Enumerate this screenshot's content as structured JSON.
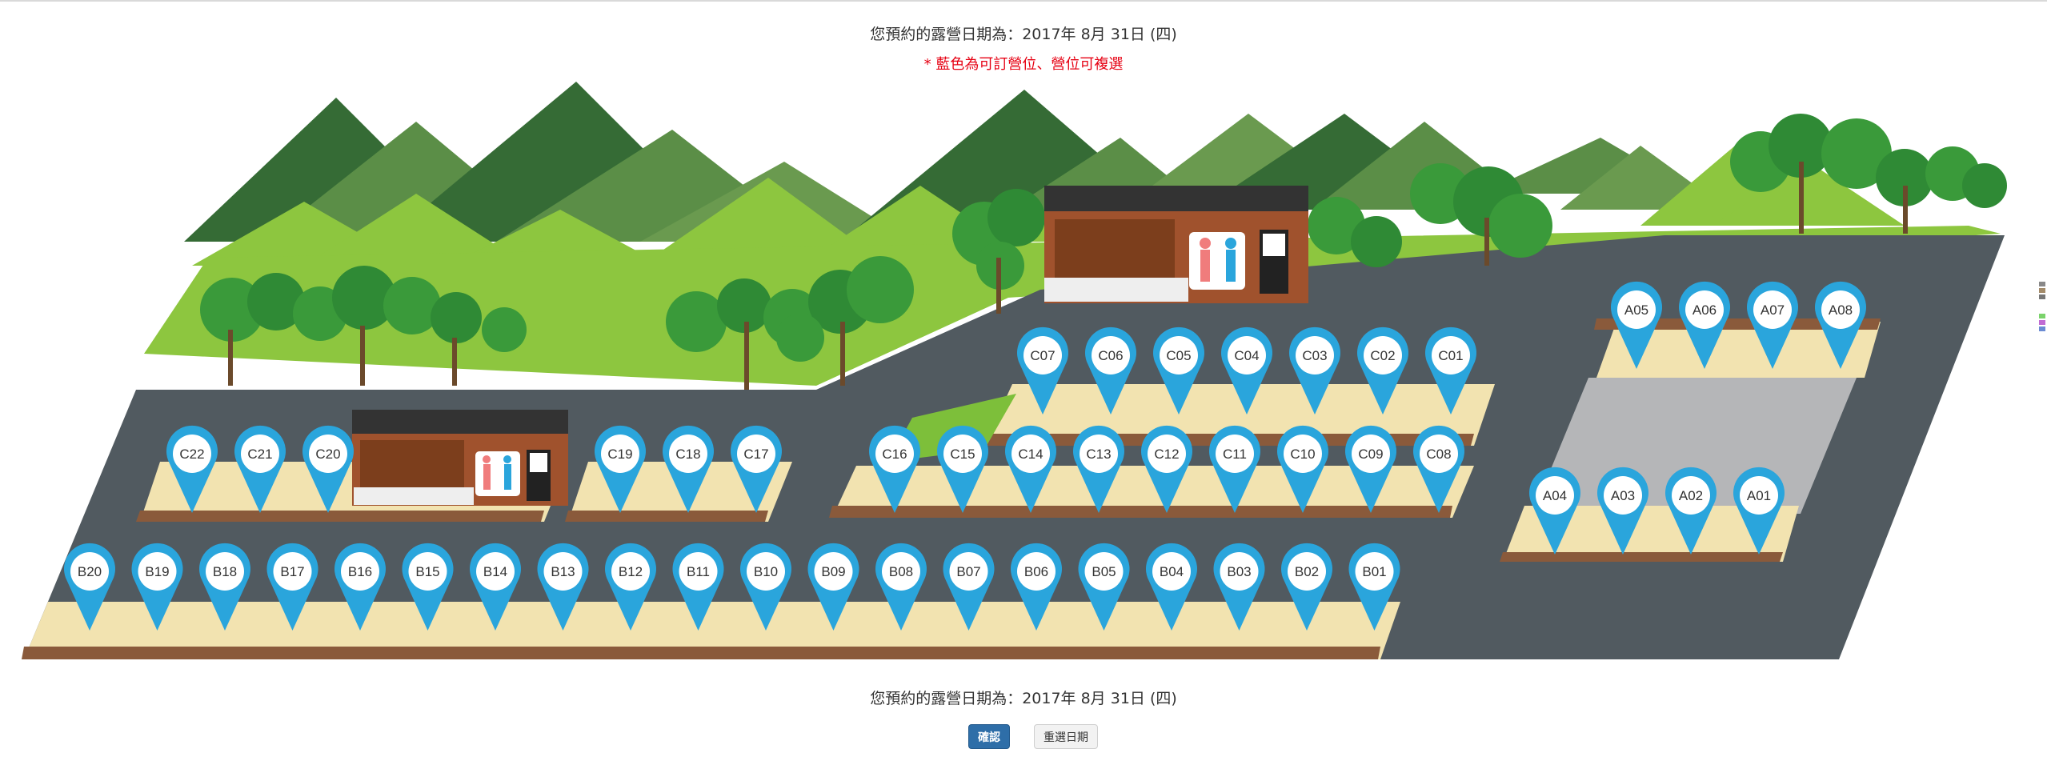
{
  "header": {
    "date_text": "您預約的露營日期為：2017年 8月 31日 (四)",
    "note": "* 藍色為可訂營位、營位可複選"
  },
  "footer": {
    "date_text": "您預約的露營日期為：2017年 8月 31日 (四)",
    "confirm_label": "確認",
    "reselect_label": "重選日期"
  },
  "colors": {
    "marker_blue": "#2aa5dc",
    "road": "#515a60",
    "grass": "#8dc63f",
    "mountain_dark": "#356b35",
    "mountain_mid": "#5b8e47",
    "pad": "#f2e3b0",
    "building": "#a0522d"
  },
  "sites": {
    "A": [
      "A05",
      "A06",
      "A07",
      "A08",
      "A04",
      "A03",
      "A02",
      "A01"
    ],
    "B": [
      "B20",
      "B19",
      "B18",
      "B17",
      "B16",
      "B15",
      "B14",
      "B13",
      "B12",
      "B11",
      "B10",
      "B09",
      "B08",
      "B07",
      "B06",
      "B05",
      "B04",
      "B03",
      "B02",
      "B01"
    ],
    "C_upper": [
      "C07",
      "C06",
      "C05",
      "C04",
      "C03",
      "C02",
      "C01"
    ],
    "C_left": [
      "C22",
      "C21",
      "C20"
    ],
    "C_middle": [
      "C19",
      "C18",
      "C17"
    ],
    "C_lower": [
      "C16",
      "C15",
      "C14",
      "C13",
      "C12",
      "C11",
      "C10",
      "C09",
      "C08"
    ]
  }
}
